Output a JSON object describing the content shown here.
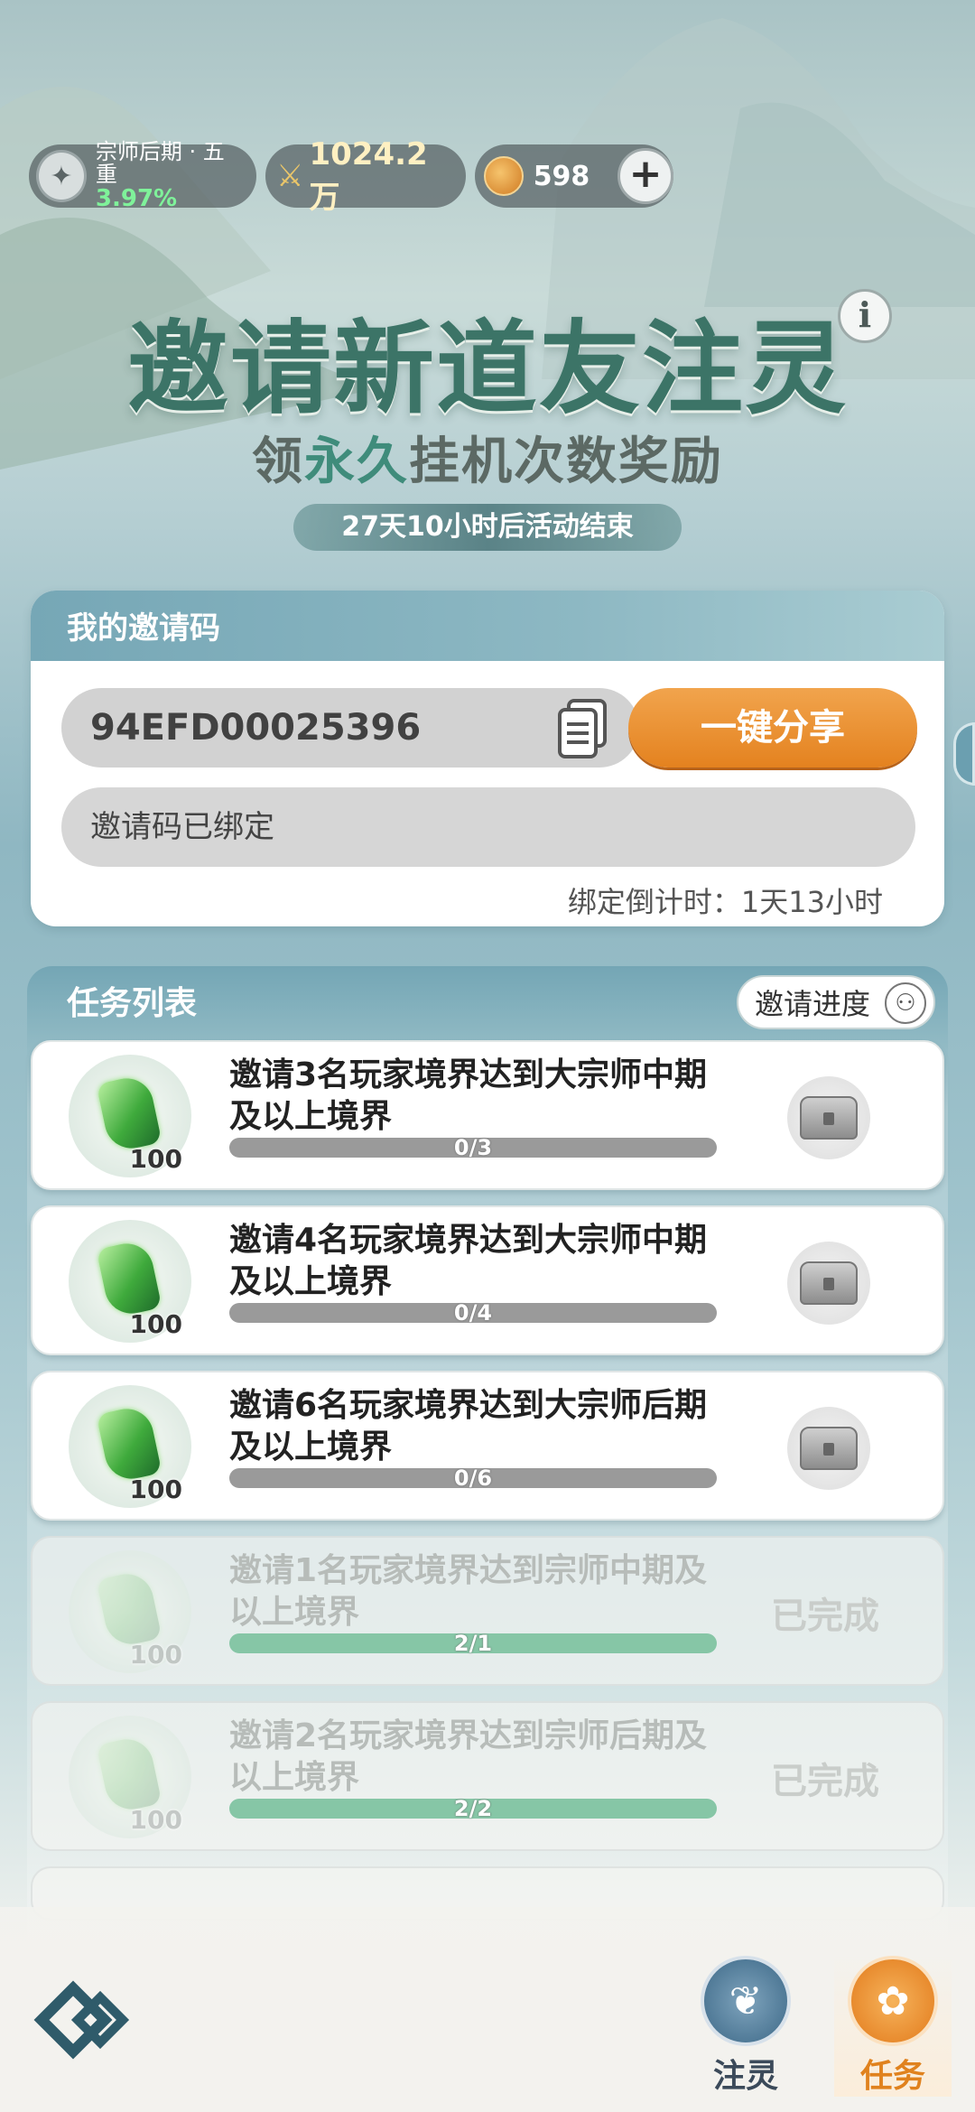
{
  "top_bar": {
    "rank_title": "宗师后期 · 五重",
    "rank_percent": "3.97%",
    "power_value": "1024.2万",
    "coin_value": "598",
    "plus_label": "+"
  },
  "banner": {
    "title_part1": "邀请新道友",
    "title_highlight": "注",
    "title_part2": "灵",
    "info_label": "i",
    "subtitle_part1": "领",
    "subtitle_highlight": "永久",
    "subtitle_part2": "挂机次数奖励",
    "countdown": "27天10小时后活动结束"
  },
  "invite_card": {
    "header": "我的邀请码",
    "code": "94EFD00025396",
    "share_label": "一键分享",
    "bound_status": "邀请码已绑定",
    "bind_countdown": "绑定倒计时：1天13小时"
  },
  "tasks": {
    "header": "任务列表",
    "progress_label": "邀请进度",
    "items": [
      {
        "text": "邀请3名玩家境界达到大宗师中期及以上境界",
        "reward_count": "100",
        "progress": "0/3",
        "fraction": 0,
        "status": "locked"
      },
      {
        "text": "邀请4名玩家境界达到大宗师中期及以上境界",
        "reward_count": "100",
        "progress": "0/4",
        "fraction": 0,
        "status": "locked"
      },
      {
        "text": "邀请6名玩家境界达到大宗师后期及以上境界",
        "reward_count": "100",
        "progress": "0/6",
        "fraction": 0,
        "status": "locked"
      },
      {
        "text": "邀请1名玩家境界达到宗师中期及以上境界",
        "reward_count": "100",
        "progress": "2/1",
        "fraction": 1,
        "status": "已完成"
      },
      {
        "text": "邀请2名玩家境界达到宗师后期及以上境界",
        "reward_count": "100",
        "progress": "2/2",
        "fraction": 1,
        "status": "已完成"
      }
    ]
  },
  "bottom_nav": {
    "zhuling_label": "注灵",
    "task_label": "任务"
  },
  "colors": {
    "accent_orange": "#e4821f",
    "accent_teal": "#3c7467",
    "header_blue": "#76a7b6"
  }
}
